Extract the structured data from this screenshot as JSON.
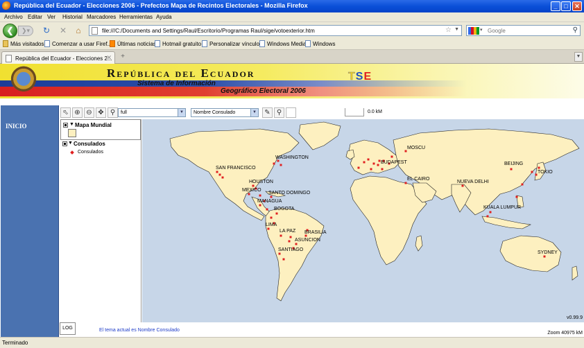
{
  "window": {
    "title": "República del Ecuador - Elecciones 2006 - Prefectos Mapa de Recintos Electorales - Mozilla Firefox",
    "controls": [
      "_",
      "□",
      "✕"
    ]
  },
  "menu": [
    "Archivo",
    "Editar",
    "Ver",
    "Historial",
    "Marcadores",
    "Herramientas",
    "Ayuda"
  ],
  "nav": {
    "url": "file:///C:/Documents and Settings/Raul/Escritorio/Programas Raul/sige/votoexterior.htm",
    "search_placeholder": "Google"
  },
  "bookmarks": [
    "Más visitados",
    "Comenzar a usar Firef...",
    "Últimas noticias",
    "Hotmail gratuito",
    "Personalizar vínculos",
    "Windows Media",
    "Windows"
  ],
  "tab": {
    "label": "República del Ecuador - Elecciones 2..."
  },
  "banner": {
    "title": "República del Ecuador",
    "subtitle1": "Sistema de Información",
    "subtitle2": "Geográfico Electoral 2006",
    "logo_t": "T",
    "logo_s": "S",
    "logo_e": "E"
  },
  "sidebar": {
    "inicio": "INICIO"
  },
  "toolbar": {
    "extent_select": "full",
    "field_select": "Nombre Consulado",
    "scale": "0.0 kM"
  },
  "layers": {
    "layer1": "Mapa Mundial",
    "layer2": "Consulados",
    "legend_item": "Consulados"
  },
  "map": {
    "background": "#c7d6e8",
    "land": "#fdf0c0",
    "point_color": "#e02020",
    "cities": [
      {
        "name": "SAN FRANCISCO"
      },
      {
        "name": "WASHINGTON"
      },
      {
        "name": "HOUSTON"
      },
      {
        "name": "MEXICO"
      },
      {
        "name": "SANTO DOMINGO"
      },
      {
        "name": "MANAGUA"
      },
      {
        "name": "BOGOTA"
      },
      {
        "name": "LIMA"
      },
      {
        "name": "LA PAZ"
      },
      {
        "name": "BRASILIA"
      },
      {
        "name": "ASUNCION"
      },
      {
        "name": "SANTIAGO"
      },
      {
        "name": "MOSCU"
      },
      {
        "name": "BUDAPEST"
      },
      {
        "name": "EL CAIRO"
      },
      {
        "name": "NUEVA DELHI"
      },
      {
        "name": "BEIJING"
      },
      {
        "name": "TOKIO"
      },
      {
        "name": "KUALA LUMPUR"
      },
      {
        "name": "SYDNEY"
      }
    ],
    "version": "v0.99.9"
  },
  "bottom": {
    "log": "LOG",
    "tema": "El tema actual es Nombre Consulado",
    "zoom": "Zoom 40975 kM"
  },
  "status": "Terminado"
}
